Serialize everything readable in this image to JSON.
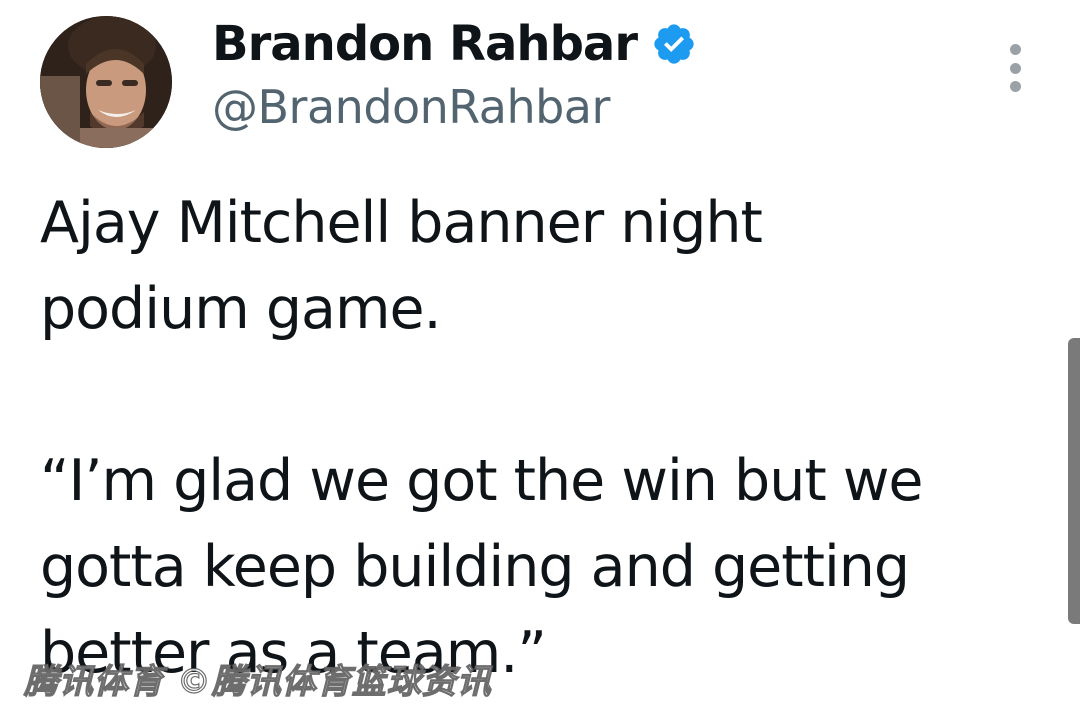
{
  "author": {
    "display_name": "Brandon Rahbar",
    "handle": "@BrandonRahbar",
    "verified": true,
    "verified_badge_color": "#1d9bf0"
  },
  "tweet": {
    "lines": [
      "Ajay Mitchell banner night",
      "podium game.",
      "",
      "“I’m glad we got the win but we",
      "gotta keep building and getting",
      "better as a team.”"
    ]
  },
  "watermark": {
    "text": "腾讯体育 ©腾讯体育篮球资讯"
  },
  "icons": {
    "more": "more-vertical-icon",
    "verified": "verified-badge-icon"
  },
  "colors": {
    "text_primary": "#0f1419",
    "text_secondary": "#536471",
    "accent": "#1d9bf0"
  }
}
